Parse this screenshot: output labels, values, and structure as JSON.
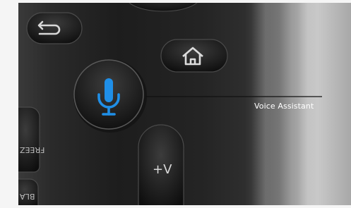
{
  "callout": {
    "label": "Voice Assistant"
  },
  "keys": {
    "volume_label": "+V",
    "freeze_label": "FREEZ",
    "blank_label": "BLA"
  },
  "icons": {
    "back": "back-arrow-icon",
    "home": "home-icon",
    "voice": "microphone-icon"
  },
  "colors": {
    "mic_accent": "#1f8fe8",
    "button_fill": "#262626",
    "label_text": "#ffffff"
  }
}
